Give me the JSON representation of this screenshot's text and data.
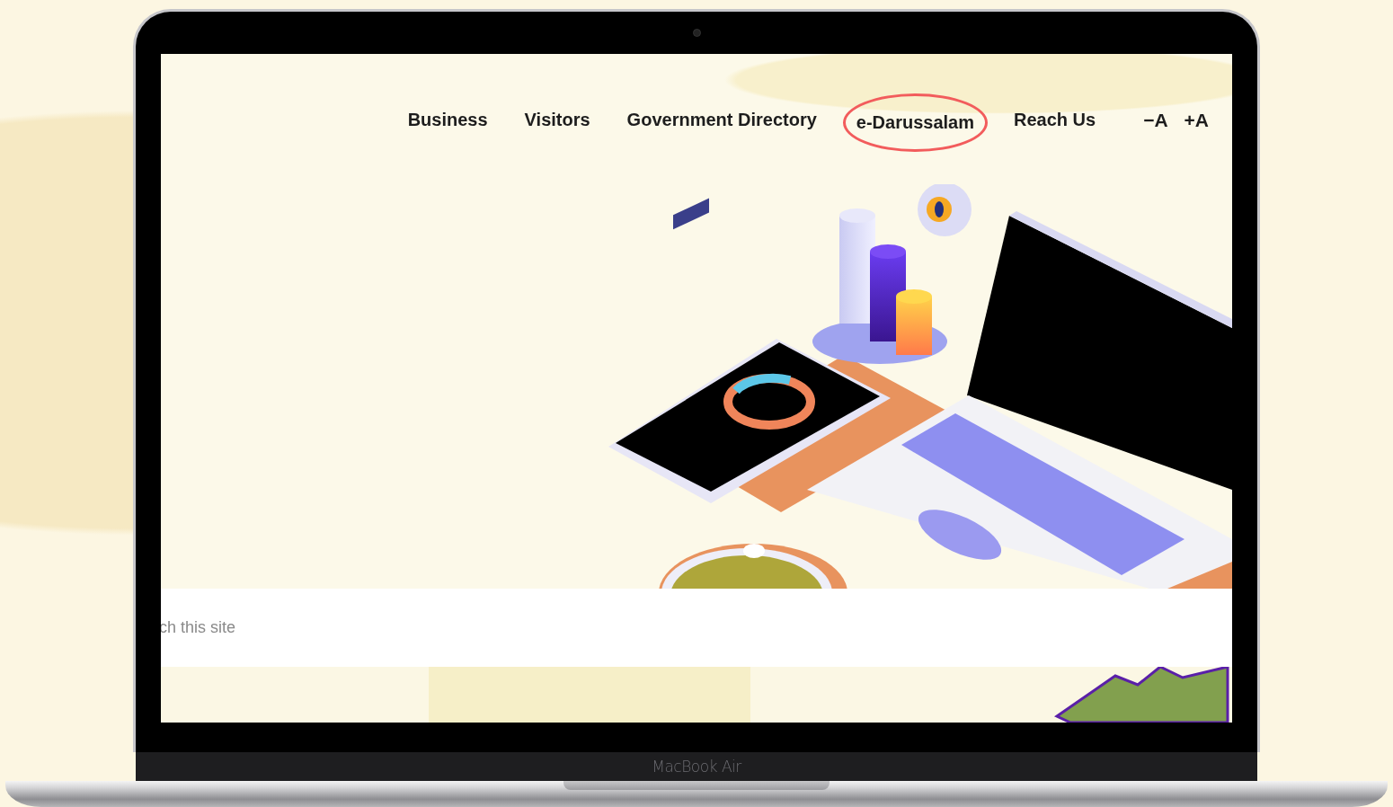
{
  "nav": {
    "items": [
      {
        "label": "Business",
        "highlighted": false
      },
      {
        "label": "Visitors",
        "highlighted": false
      },
      {
        "label": "Government Directory",
        "highlighted": false
      },
      {
        "label": "e-Darussalam",
        "highlighted": true
      },
      {
        "label": "Reach Us",
        "highlighted": false
      }
    ],
    "font_controls": [
      {
        "sign": "−",
        "letter": "A"
      },
      {
        "sign": "+",
        "letter": "A"
      }
    ]
  },
  "search": {
    "placeholder": "ch this site"
  },
  "device": {
    "label": "MacBook Air"
  }
}
